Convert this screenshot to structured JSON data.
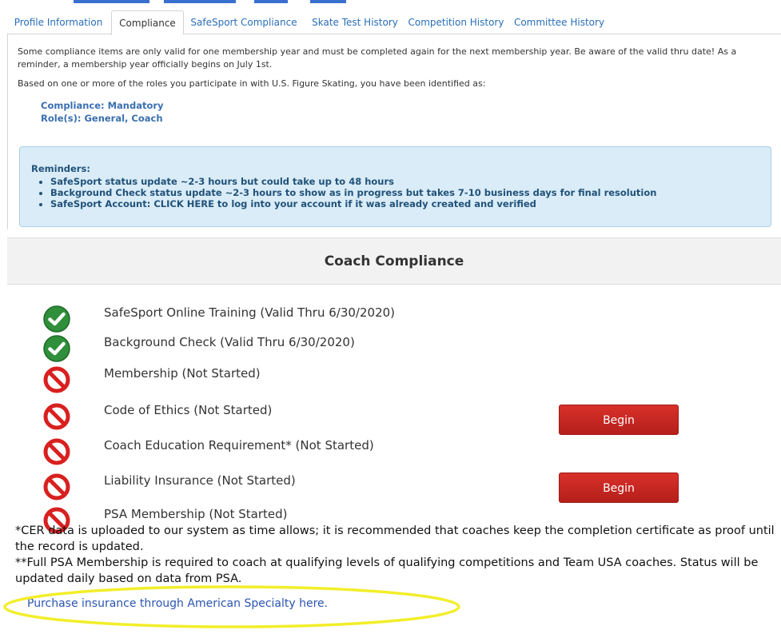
{
  "tabs": [
    {
      "label": "Profile Information",
      "active": false
    },
    {
      "label": "Compliance",
      "active": true
    },
    {
      "label": "SafeSport Compliance",
      "active": false
    },
    {
      "label": "Skate Test History",
      "active": false
    },
    {
      "label": "Competition History",
      "active": false
    },
    {
      "label": "Committee History",
      "active": false
    }
  ],
  "intro": {
    "paragraph1": "Some compliance items are only valid for one membership year and must be completed again for the next membership year. Be aware of the valid thru date! As a reminder, a membership year officially begins on July 1st.",
    "paragraph2": "Based on one or more of the roles you participate in with U.S. Figure Skating, you have been identified as:",
    "compliance": "Compliance: Mandatory",
    "roles": "Role(s): General, Coach"
  },
  "reminders": {
    "title": "Reminders:",
    "items": [
      "SafeSport status update ~2-3 hours but could take up to 48 hours",
      "Background Check status update ~2-3 hours to show as in progress but takes 7-10 business days for final resolution",
      "SafeSport Account:  CLICK HERE  to log into your account if it was already created and verified"
    ]
  },
  "coach_compliance": {
    "title": "Coach Compliance",
    "begin_label": "Begin",
    "items": [
      {
        "label": "SafeSport Online Training (Valid Thru 6/30/2020)",
        "status": "complete",
        "icon": "check-circle-icon"
      },
      {
        "label": "Background Check (Valid Thru 6/30/2020)",
        "status": "complete",
        "icon": "check-circle-icon"
      },
      {
        "label": "Membership (Not Started)",
        "status": "not-started",
        "icon": "prohibited-icon"
      },
      {
        "label": "Code of Ethics (Not Started)",
        "status": "not-started",
        "icon": "prohibited-icon",
        "has_begin": true
      },
      {
        "label": "Coach Education Requirement* (Not Started)",
        "status": "not-started",
        "icon": "prohibited-icon"
      },
      {
        "label": "Liability Insurance (Not Started)",
        "status": "not-started",
        "icon": "prohibited-icon",
        "has_begin": true
      },
      {
        "label": "PSA Membership (Not Started)",
        "status": "not-started",
        "icon": "prohibited-icon"
      }
    ]
  },
  "notes": {
    "cer": "*CER data is uploaded to our system as time allows; it is recommended that coaches keep the completion certificate as proof until the record is updated.",
    "psa": "**Full PSA Membership is required to coach at qualifying levels of qualifying competitions and Team USA coaches. Status will be updated daily based on data from PSA."
  },
  "insurance_link": "Purchase insurance through American Specialty here.",
  "colors": {
    "link": "#2a6eb7",
    "status_blue": "#3a6fb0",
    "reminder_bg": "#d9ecf7",
    "check_green": "#2f8f3a",
    "prohibited_red": "#d8201f",
    "begin_red": "#c9241f",
    "highlight_yellow": "#f2ee2a"
  }
}
